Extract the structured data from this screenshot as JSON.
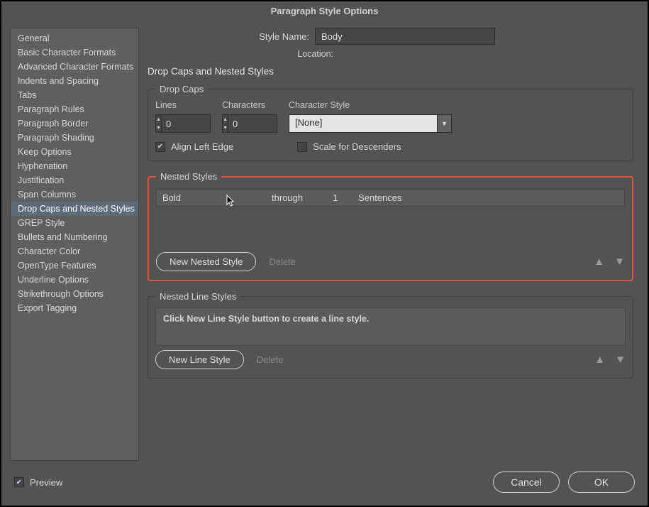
{
  "title": "Paragraph Style Options",
  "sidebar": {
    "items": [
      "General",
      "Basic Character Formats",
      "Advanced Character Formats",
      "Indents and Spacing",
      "Tabs",
      "Paragraph Rules",
      "Paragraph Border",
      "Paragraph Shading",
      "Keep Options",
      "Hyphenation",
      "Justification",
      "Span Columns",
      "Drop Caps and Nested Styles",
      "GREP Style",
      "Bullets and Numbering",
      "Character Color",
      "OpenType Features",
      "Underline Options",
      "Strikethrough Options",
      "Export Tagging"
    ],
    "selected_index": 12
  },
  "header": {
    "style_name_label": "Style Name:",
    "style_name_value": "Body",
    "location_label": "Location:"
  },
  "section_title": "Drop Caps and Nested Styles",
  "dropcaps": {
    "legend": "Drop Caps",
    "lines_label": "Lines",
    "lines_value": "0",
    "chars_label": "Characters",
    "chars_value": "0",
    "charstyle_label": "Character Style",
    "charstyle_value": "[None]",
    "align_left_label": "Align Left Edge",
    "align_left_checked": true,
    "scale_desc_label": "Scale for Descenders",
    "scale_desc_checked": false
  },
  "nested": {
    "legend": "Nested Styles",
    "row": {
      "style": "Bold",
      "op": "through",
      "count": "1",
      "unit": "Sentences"
    },
    "new_btn": "New Nested Style",
    "delete_btn": "Delete"
  },
  "nested_line": {
    "legend": "Nested Line Styles",
    "placeholder": "Click New Line Style button to create a line style.",
    "new_btn": "New Line Style",
    "delete_btn": "Delete"
  },
  "footer": {
    "preview_label": "Preview",
    "preview_checked": true,
    "cancel": "Cancel",
    "ok": "OK"
  }
}
